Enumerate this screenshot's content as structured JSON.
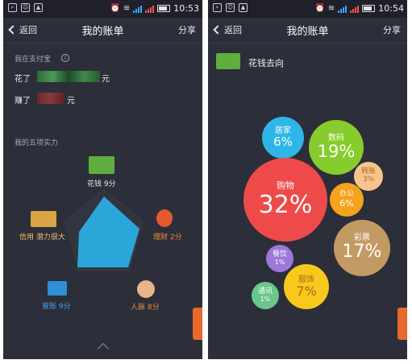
{
  "status_bar": {
    "left": {
      "time": "10:53"
    },
    "right": {
      "time": "10:54"
    }
  },
  "nav": {
    "back_label": "返回",
    "title": "我的账单",
    "share_label": "分享"
  },
  "left": {
    "alipay_label": "我在支付宝",
    "spent_prefix": "花了",
    "earned_prefix": "赚了",
    "currency": "元",
    "strengths_label": "我的五项实力",
    "radar": {
      "spending": "花钱 9分",
      "finance": "理财 2分",
      "network": "人脉 8分",
      "accounts": "管账 9分",
      "credit": "信用 潜力很大"
    }
  },
  "right": {
    "heading": "花钱去向",
    "bubbles": [
      {
        "name": "居家",
        "percent": "6%",
        "color": "#2fb6e9"
      },
      {
        "name": "数码",
        "percent": "19%",
        "color": "#86cc2c"
      },
      {
        "name": "转账",
        "percent": "3%",
        "color": "#f7c58b"
      },
      {
        "name": "购物",
        "percent": "32%",
        "color": "#ef4a4a"
      },
      {
        "name": "办公",
        "percent": "6%",
        "color": "#f5a21c"
      },
      {
        "name": "彩票",
        "percent": "17%",
        "color": "#c39a63"
      },
      {
        "name": "餐饮",
        "percent": "1%",
        "color": "#9b78d9"
      },
      {
        "name": "服饰",
        "percent": "7%",
        "color": "#f8c81c"
      },
      {
        "name": "通讯",
        "percent": "1%",
        "color": "#69c68d"
      }
    ]
  }
}
